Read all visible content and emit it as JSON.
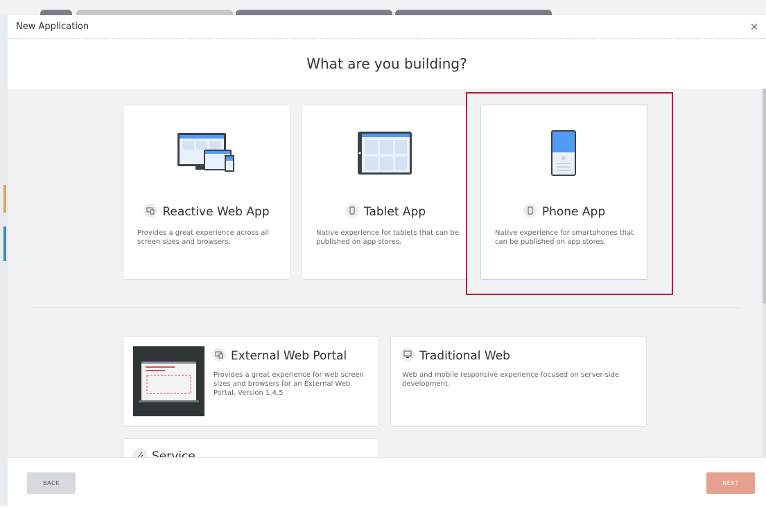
{
  "dialog": {
    "title": "New Application",
    "close_icon": "close-icon",
    "heading": "What are you building?"
  },
  "app_types": [
    {
      "title": "Reactive Web App",
      "icon": "reactive-icon",
      "description": "Provides a great experience across all screen sizes and browsers.",
      "selected": false
    },
    {
      "title": "Tablet App",
      "icon": "tablet-icon",
      "description": "Native experience for tablets that can be published on app stores.",
      "selected": false
    },
    {
      "title": "Phone App",
      "icon": "phone-icon",
      "description": "Native experience for smartphones that can be published on app stores.",
      "selected": true
    }
  ],
  "templates": [
    {
      "title": "External Web Portal",
      "icon": "reactive-icon",
      "description": "Provides a great experience for web screen sizes and browsers for an External Web Portal. Version 1.4.5"
    },
    {
      "title": "Traditional Web",
      "icon": "monitor-icon",
      "description": "Web and mobile responsive experience focused on server-side development."
    },
    {
      "title": "Service",
      "icon": "service-icon"
    }
  ],
  "footer": {
    "back_label": "BACK",
    "next_label": "NEXT"
  },
  "colors": {
    "accent_highlight": "#c8102e",
    "next_button": "#e8a08e",
    "back_button": "#d6dade",
    "content_bg": "#f1f2f4",
    "illustration_blue": "#4f9bf5"
  }
}
